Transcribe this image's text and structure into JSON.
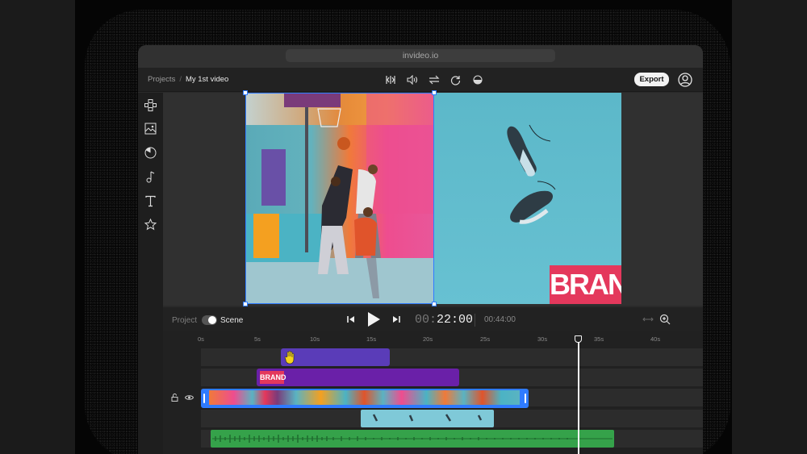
{
  "browser": {
    "url": "invideo.io"
  },
  "breadcrumb": {
    "root": "Projects",
    "separator": "/",
    "current": "My 1st video"
  },
  "header": {
    "export_label": "Export"
  },
  "toolbar_icons": [
    "split-icon",
    "volume-icon",
    "swap-icon",
    "rotate-icon",
    "opacity-icon"
  ],
  "sidebar_icons": [
    "layout-icon",
    "media-icon",
    "sticker-icon",
    "music-icon",
    "text-icon",
    "star-icon"
  ],
  "canvas": {
    "brand_text": "BRAND",
    "brand_color": "#e4385c",
    "selection_color": "#2f7bff"
  },
  "playback": {
    "project_label": "Project",
    "scene_label": "Scene",
    "current_time_dim": "00:",
    "current_time": "22:00",
    "total_time": "00:44:00"
  },
  "ruler": [
    "0s",
    "5s",
    "10s",
    "15s",
    "20s",
    "25s",
    "30s",
    "35s",
    "40s"
  ],
  "tracks": {
    "sticker_clip_color": "#5a3cb8",
    "brand_clip_color": "#6a20a8",
    "video_clip_border": "#2f7bff",
    "image_clip_color": "#7fc9d8",
    "audio_clip_color": "#35a24a"
  }
}
